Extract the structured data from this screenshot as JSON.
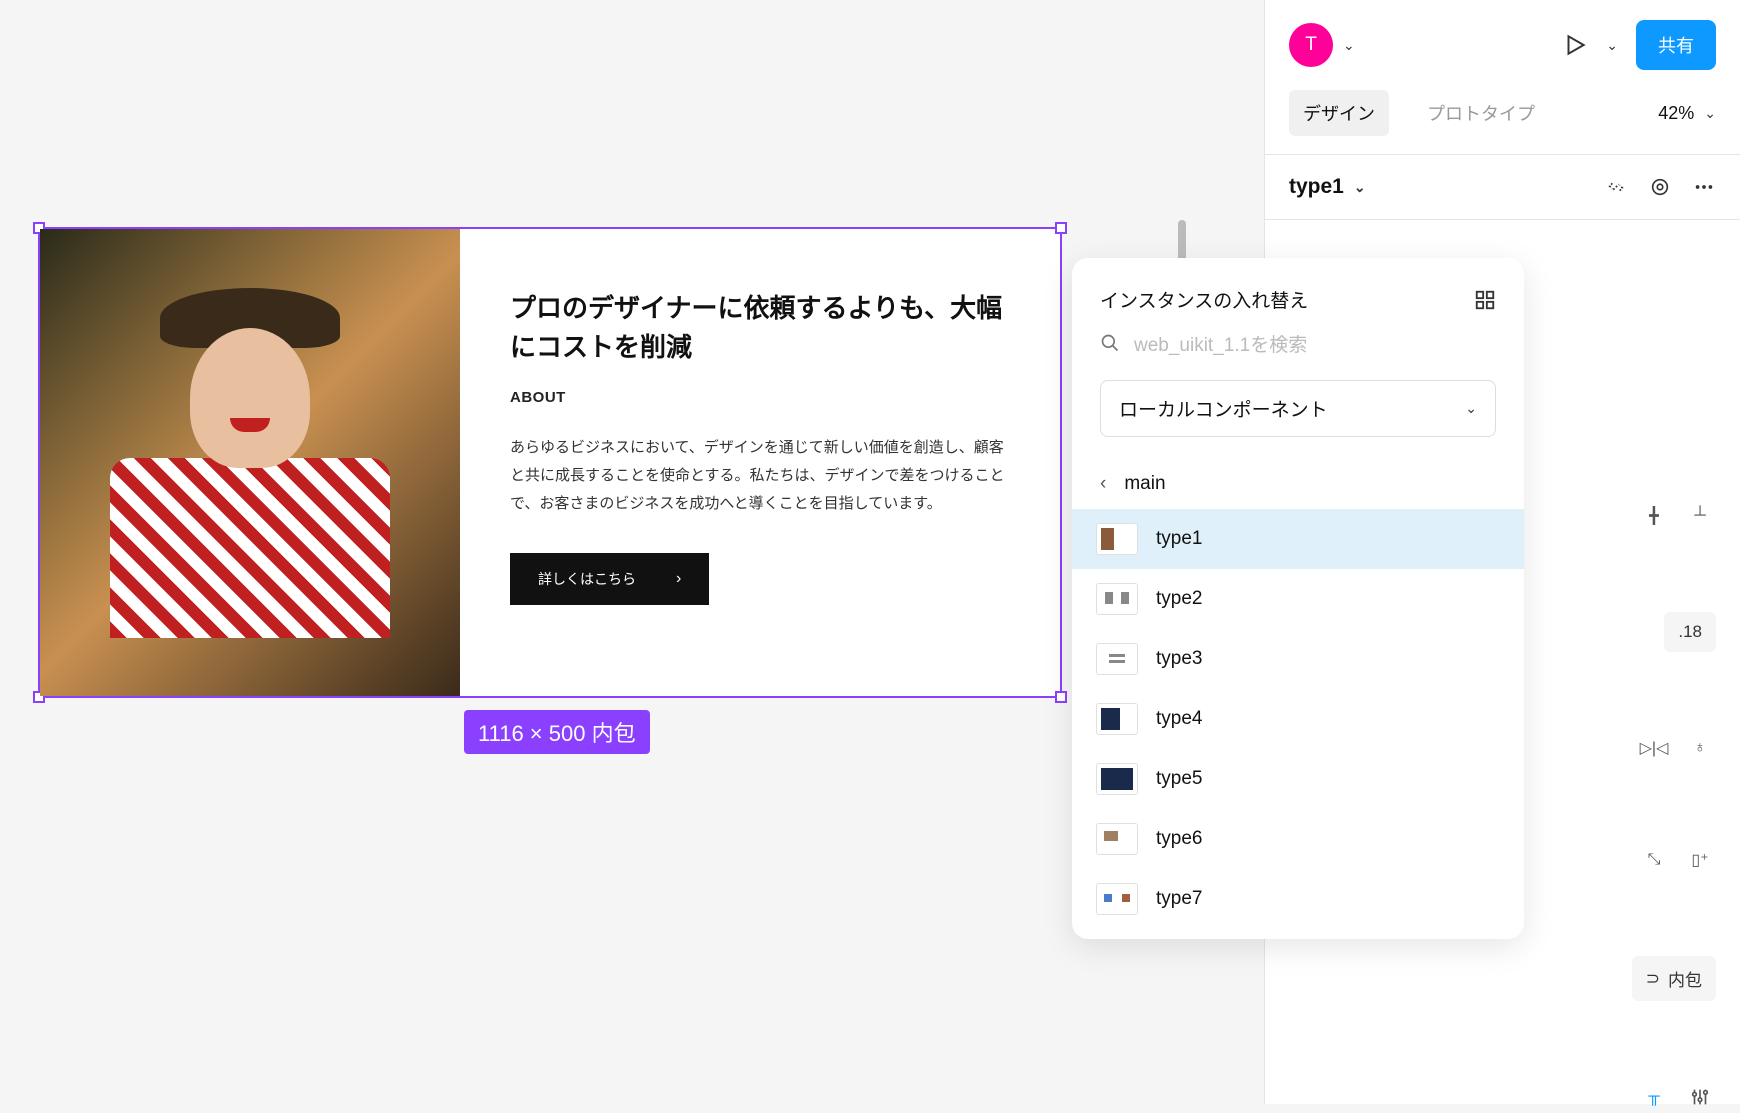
{
  "canvas": {
    "frame": {
      "heading": "プロのデザイナーに依頼するよりも、大幅にコストを削減",
      "subheading": "ABOUT",
      "body": "あらゆるビジネスにおいて、デザインを通じて新しい価値を創造し、顧客と共に成長することを使命とする。私たちは、デザインで差をつけることで、お客さまのビジネスを成功へと導くことを目指しています。",
      "button": "詳しくはこちら"
    },
    "dimensions": "1116 × 500 内包"
  },
  "panel": {
    "avatar_letter": "T",
    "share": "共有",
    "tabs": {
      "design": "デザイン",
      "prototype": "プロトタイプ"
    },
    "zoom": "42%",
    "instance_name": "type1"
  },
  "popup": {
    "title": "インスタンスの入れ替え",
    "search_placeholder": "web_uikit_1.1を検索",
    "dropdown": "ローカルコンポーネント",
    "breadcrumb": "main",
    "items": [
      {
        "label": "type1"
      },
      {
        "label": "type2"
      },
      {
        "label": "type3"
      },
      {
        "label": "type4"
      },
      {
        "label": "type5"
      },
      {
        "label": "type6"
      },
      {
        "label": "type7"
      }
    ]
  },
  "controls": {
    "value1": ".18",
    "value2": "内包"
  }
}
